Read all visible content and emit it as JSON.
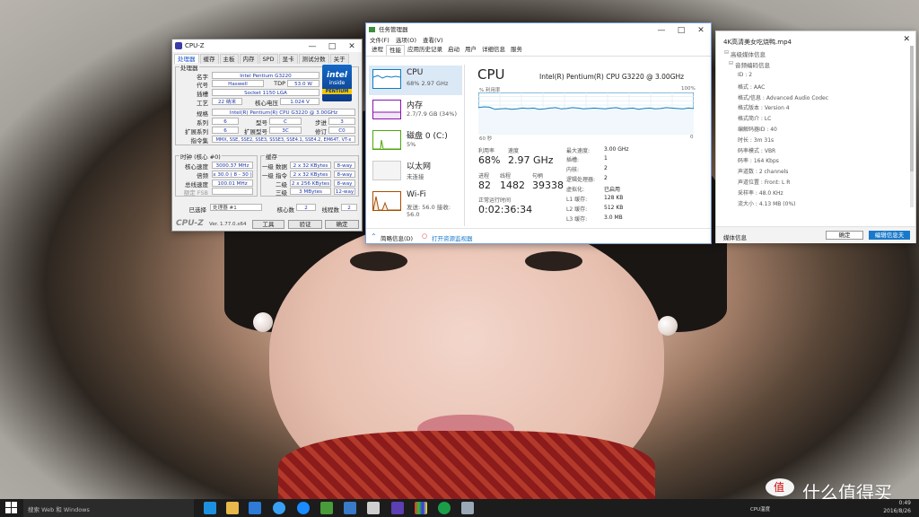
{
  "colors": {
    "accent": "#1979ca",
    "cpu_graph": "#117dbb",
    "mem_graph": "#8b12ae",
    "disk_graph": "#4da60c",
    "wifi_graph": "#a74f01"
  },
  "cpuz": {
    "title": "CPU-Z",
    "tabs": [
      "处理器",
      "缓存",
      "主板",
      "内存",
      "SPD",
      "显卡",
      "测试分数",
      "关于"
    ],
    "processor_group": "处理器",
    "labels": {
      "name": "名字",
      "codename": "代号",
      "tdp": "TDP",
      "package": "插槽",
      "tech": "工艺",
      "voltage": "核心电压",
      "spec": "规格",
      "family": "系列",
      "model": "型号",
      "stepping": "步进",
      "ext_family": "扩展系列",
      "ext_model": "扩展型号",
      "revision": "修订",
      "instructions": "指令集"
    },
    "values": {
      "name": "Intel Pentium G3220",
      "codename": "Haswell",
      "tdp": "53.0 W",
      "package": "Socket 1150 LGA",
      "tech": "22 纳米",
      "voltage": "1.024 V",
      "spec": "Intel(R) Pentium(R) CPU G3220 @ 3.00GHz",
      "family": "6",
      "model": "C",
      "stepping": "3",
      "ext_family": "6",
      "ext_model": "3C",
      "revision": "C0",
      "instructions": "MMX, SSE, SSE2, SSE3, SSSE3, SSE4.1, SSE4.2, EM64T, VT-x"
    },
    "clocks_group": "时钟 (核心 #0)",
    "clock_labels": {
      "core_speed": "核心速度",
      "multiplier": "倍频",
      "bus_speed": "总线速度",
      "rated_fsb": "额定 FSB"
    },
    "clock_values": {
      "core_speed": "3000.37 MHz",
      "multiplier": "x 30.0 ( 8 - 30 )",
      "bus_speed": "100.01 MHz"
    },
    "cache_group": "缓存",
    "cache_labels": {
      "l1d": "一级 数据",
      "l1i": "一级 指令",
      "l2": "二级",
      "l3": "三级"
    },
    "cache_values": {
      "l1d": "2 x 32 KBytes",
      "l1d_way": "8-way",
      "l1i": "2 x 32 KBytes",
      "l1i_way": "8-way",
      "l2": "2 x 256 KBytes",
      "l2_way": "8-way",
      "l3": "3 MBytes",
      "l3_way": "12-way"
    },
    "selection_label": "已选择",
    "selection_value": "处理器 #1",
    "cores_label": "核心数",
    "cores": "2",
    "threads_label": "线程数",
    "threads": "2",
    "brand": "CPU-Z",
    "version": "Ver. 1.77.0.x64",
    "tools_button": "工具",
    "validate_button": "验证",
    "ok_button": "确定",
    "intel_logo": "intel",
    "intel_inside": "inside",
    "pentium": "PENTIUM"
  },
  "taskmgr": {
    "title": "任务管理器",
    "menu": [
      "文件(F)",
      "选项(O)",
      "查看(V)"
    ],
    "tabs": [
      "进程",
      "性能",
      "应用历史记录",
      "启动",
      "用户",
      "详细信息",
      "服务"
    ],
    "sidebar": [
      {
        "name": "CPU",
        "sub": "68% 2.97 GHz"
      },
      {
        "name": "内存",
        "sub": "2.7/7.9 GB (34%)"
      },
      {
        "name": "磁盘 0 (C:)",
        "sub": "5%"
      },
      {
        "name": "以太网",
        "sub": "未连接"
      },
      {
        "name": "Wi-Fi",
        "sub": "发送: 56.0 接收: 56.0"
      }
    ],
    "cpu_heading": "CPU",
    "cpu_model": "Intel(R) Pentium(R) CPU G3220 @ 3.00GHz",
    "util_axis": "% 利用率",
    "util_max": "100%",
    "time_axis": "60 秒",
    "time_min": "0",
    "stats_labels": {
      "util": "利用率",
      "speed": "速度",
      "processes": "进程",
      "threads": "线程",
      "handles": "句柄",
      "uptime": "正常运行时间"
    },
    "stats": {
      "util": "68%",
      "speed": "2.97 GHz",
      "processes": "82",
      "threads": "1482",
      "handles": "39338",
      "uptime": "0:02:36:34"
    },
    "specs_labels": {
      "max_speed": "最大速度:",
      "sockets": "插槽:",
      "cores": "内核:",
      "logical": "逻辑处理器:",
      "virt": "虚拟化:",
      "l1": "L1 缓存:",
      "l2": "L2 缓存:",
      "l3": "L3 缓存:"
    },
    "specs": {
      "max_speed": "3.00 GHz",
      "sockets": "1",
      "cores": "2",
      "logical": "2",
      "virt": "已启用",
      "l1": "128 KB",
      "l2": "512 KB",
      "l3": "3.0 MB"
    },
    "fewer_details": "简略信息(D)",
    "resource_monitor": "打开资源监视器",
    "cpu_graph_values": [
      64,
      66,
      65,
      60,
      61,
      62,
      60,
      61,
      63,
      62,
      63,
      60,
      61,
      63,
      64,
      61,
      62,
      64,
      63,
      61,
      62,
      63,
      62,
      61,
      63,
      64,
      61,
      62,
      63,
      60,
      62,
      63,
      61,
      62,
      64,
      63,
      62,
      61,
      63,
      62
    ]
  },
  "mediainfo": {
    "filename": "4K高清美女吃烧鸭.mp4",
    "tree_root": "高级媒体信息",
    "tree_child": "音频编码信息",
    "lines": [
      "ID : 2",
      "格式 : AAC",
      "格式/信息 : Advanced Audio Codec",
      "格式版本 : Version 4",
      "格式简介 : LC",
      "编解码器ID : 40",
      "时长 : 3m 31s",
      "码率模式 : VBR",
      "码率 : 164 Kbps",
      "声道数 : 2 channels",
      "声道位置 : Front: L R",
      "采样率 : 48.0 KHz",
      "流大小 : 4.13 MB (0%)"
    ],
    "footer_label": "媒体信息",
    "ok_button": "确定",
    "edit_button": "编辑信息夫"
  },
  "taskbar": {
    "search_placeholder": "搜索 Web 和 Windows",
    "tray_label": "CPU温度",
    "watermark": "什么值得买",
    "time": "0:49",
    "date": "2016/8/26"
  }
}
